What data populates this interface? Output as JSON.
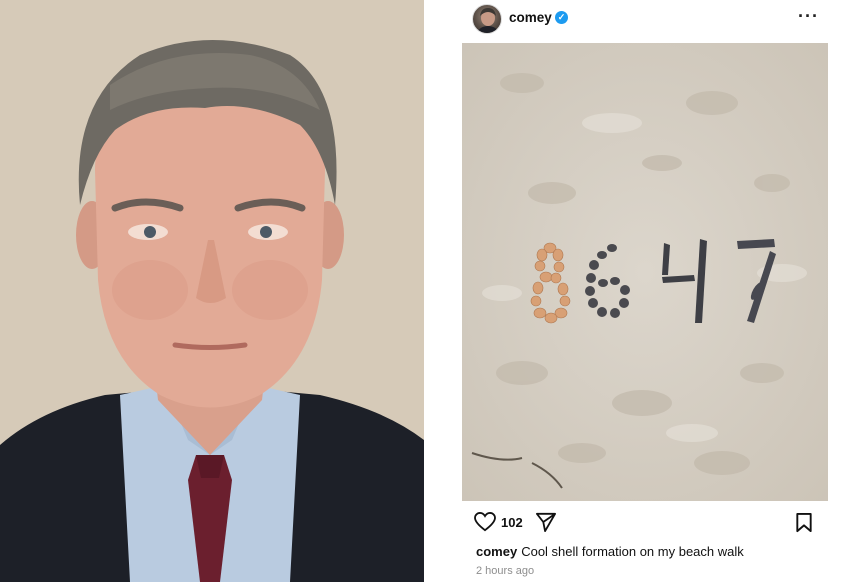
{
  "post": {
    "username": "comey",
    "verified": true,
    "more_icon": "more-horizontal-icon",
    "likes": "102",
    "caption_user": "comey",
    "caption_text": "Cool shell formation on my beach walk",
    "timestamp": "2 hours ago",
    "icons": [
      "heart-icon",
      "share-icon",
      "bookmark-icon"
    ]
  },
  "colors": {
    "verified_badge": "#1d9bf0",
    "timestamp": "#8e8e8e"
  }
}
